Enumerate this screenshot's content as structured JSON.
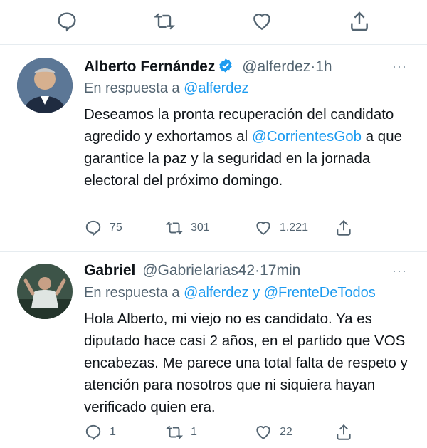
{
  "tweets": [
    {
      "name": "Alberto Fernández",
      "handle": "@alferdez",
      "time": "1h",
      "reply_prefix": "En respuesta a",
      "reply_to": "@alferdez",
      "text_1": "Deseamos la pronta recuperación del candidato agredido y exhortamos al ",
      "mention": "@CorrientesGob",
      "text_2": " a que garantice la paz y la seguridad en la jornada electoral del próximo domingo.",
      "replies": "75",
      "retweets": "301",
      "likes": "1.221",
      "verified": true
    },
    {
      "name": "Gabriel",
      "handle": "@Gabrielarias42",
      "time": "17min",
      "reply_prefix": "En respuesta a",
      "reply_to": "@alferdez",
      "reply_and": "y",
      "reply_to_2": "@FrenteDeTodos",
      "text": "Hola Alberto, mi viejo no es candidato. Ya es diputado hace casi 2 años, en el partido que VOS encabezas. Me parece una total falta de respeto y atención para nosotros que ni siquiera hayan verificado quien era.",
      "replies": "1",
      "retweets": "1",
      "likes": "22"
    }
  ],
  "more_icon": "···",
  "dot": "·",
  "colors": {
    "link": "#1d9bf0",
    "muted": "#536471",
    "verified": "#1d9bf0"
  }
}
